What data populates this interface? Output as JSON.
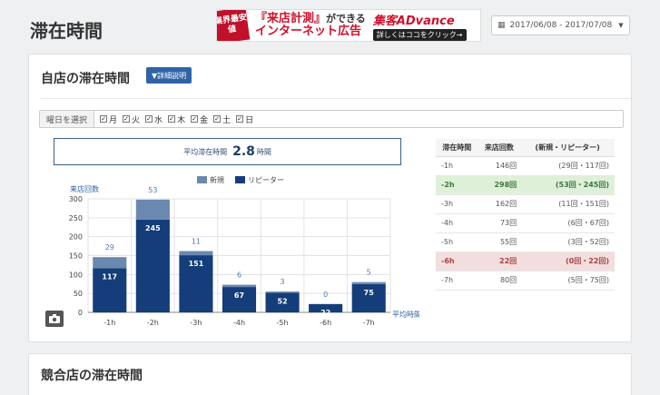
{
  "page": {
    "title": "滞在時間"
  },
  "ad": {
    "badge": "業界最安値",
    "line1": "『来店計測』",
    "line1_suffix": "ができる",
    "line2": "インターネット広告",
    "brand": "集客ADvance",
    "cta": "詳しくはココをクリック→"
  },
  "date_range": {
    "value": "2017/06/08 - 2017/07/08",
    "icon": "calendar-icon"
  },
  "main_panel": {
    "title": "自店の滞在時間",
    "detail_button": "▼詳細説明",
    "day_filter_label": "曜日を選択",
    "days": [
      "月",
      "火",
      "水",
      "木",
      "金",
      "土",
      "日"
    ],
    "avg_label": "平均滞在時間",
    "avg_value": "2.8",
    "avg_unit": "時間"
  },
  "chart_data": {
    "type": "bar",
    "stacked": true,
    "ylabel": "来店回数",
    "xlabel": "平均時間",
    "ylim": [
      0,
      300
    ],
    "yticks": [
      0,
      50,
      100,
      150,
      200,
      250,
      300
    ],
    "categories": [
      "-1h",
      "-2h",
      "-3h",
      "-4h",
      "-5h",
      "-6h",
      "-7h"
    ],
    "series": [
      {
        "name": "新規",
        "values": [
          29,
          53,
          11,
          6,
          3,
          0,
          5
        ],
        "color": "#6b88b0"
      },
      {
        "name": "リピーター",
        "values": [
          117,
          245,
          151,
          67,
          52,
          22,
          75
        ],
        "color": "#143d7a"
      }
    ],
    "legend_position": "top",
    "grid": true
  },
  "table": {
    "headers": [
      "滞在時間",
      "来店回数",
      "(新規・リピーター)"
    ],
    "rows": [
      {
        "time": "-1h",
        "count": "146回",
        "detail": "(29回・117回)",
        "style": ""
      },
      {
        "time": "-2h",
        "count": "298回",
        "detail": "(53回・245回)",
        "style": "hi-green"
      },
      {
        "time": "-3h",
        "count": "162回",
        "detail": "(11回・151回)",
        "style": ""
      },
      {
        "time": "-4h",
        "count": "73回",
        "detail": "(6回・67回)",
        "style": ""
      },
      {
        "time": "-5h",
        "count": "55回",
        "detail": "(3回・52回)",
        "style": ""
      },
      {
        "time": "-6h",
        "count": "22回",
        "detail": "(0回・22回)",
        "style": "hi-red"
      },
      {
        "time": "-7h",
        "count": "80回",
        "detail": "(5回・75回)",
        "style": ""
      }
    ]
  },
  "competitor_panel": {
    "title": "競合店の滞在時間"
  }
}
